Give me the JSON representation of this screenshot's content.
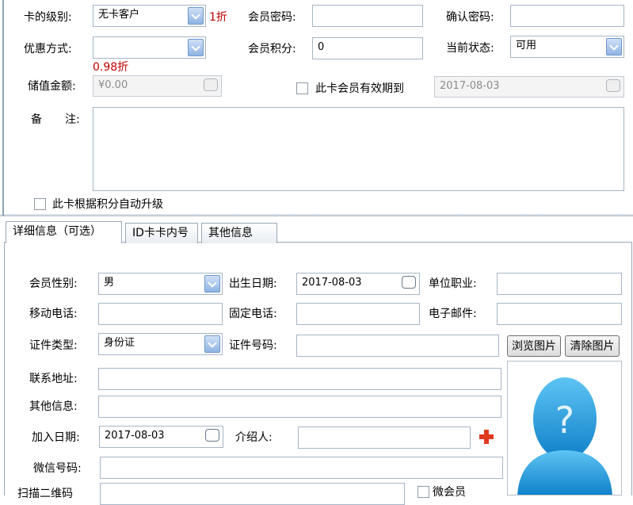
{
  "card": {
    "level_label": "卡的级别:",
    "level_value": "无卡客户",
    "level_discount": "1折",
    "password_label": "会员密码:",
    "confirm_label": "确认密码:",
    "discount_method_label": "优惠方式:",
    "discount_method_value": "",
    "discount_rate": "0.98折",
    "points_label": "会员积分:",
    "points_value": "0",
    "status_label": "当前状态:",
    "status_value": "可用",
    "stored_label": "储值金额:",
    "stored_value": "¥0.00",
    "validity_label": "此卡会员有效期到",
    "validity_date": "2017-08-03",
    "remark_label_1": "备",
    "remark_label_2": "注:",
    "auto_upgrade_label": "此卡根据积分自动升级"
  },
  "tabs": [
    {
      "label": "详细信息（可选）"
    },
    {
      "label": "ID卡卡内号"
    },
    {
      "label": "其他信息"
    }
  ],
  "detail": {
    "gender_label": "会员性别:",
    "gender_value": "男",
    "birth_label": "出生日期:",
    "birth_value": "2017-08-03",
    "job_label": "单位职业:",
    "mobile_label": "移动电话:",
    "phone_label": "固定电话:",
    "email_label": "电子邮件:",
    "idtype_label": "证件类型:",
    "idtype_value": "身份证",
    "idno_label": "证件号码:",
    "browse_label": "浏览图片",
    "clear_label": "清除图片",
    "address_label": "联系地址:",
    "other_label": "其他信息:",
    "join_label": "加入日期:",
    "join_value": "2017-08-03",
    "referrer_label": "介绍人:",
    "wechat_label": "微信号码:",
    "scan_label": "扫描二维码",
    "wechat_member_label": "微会员"
  }
}
